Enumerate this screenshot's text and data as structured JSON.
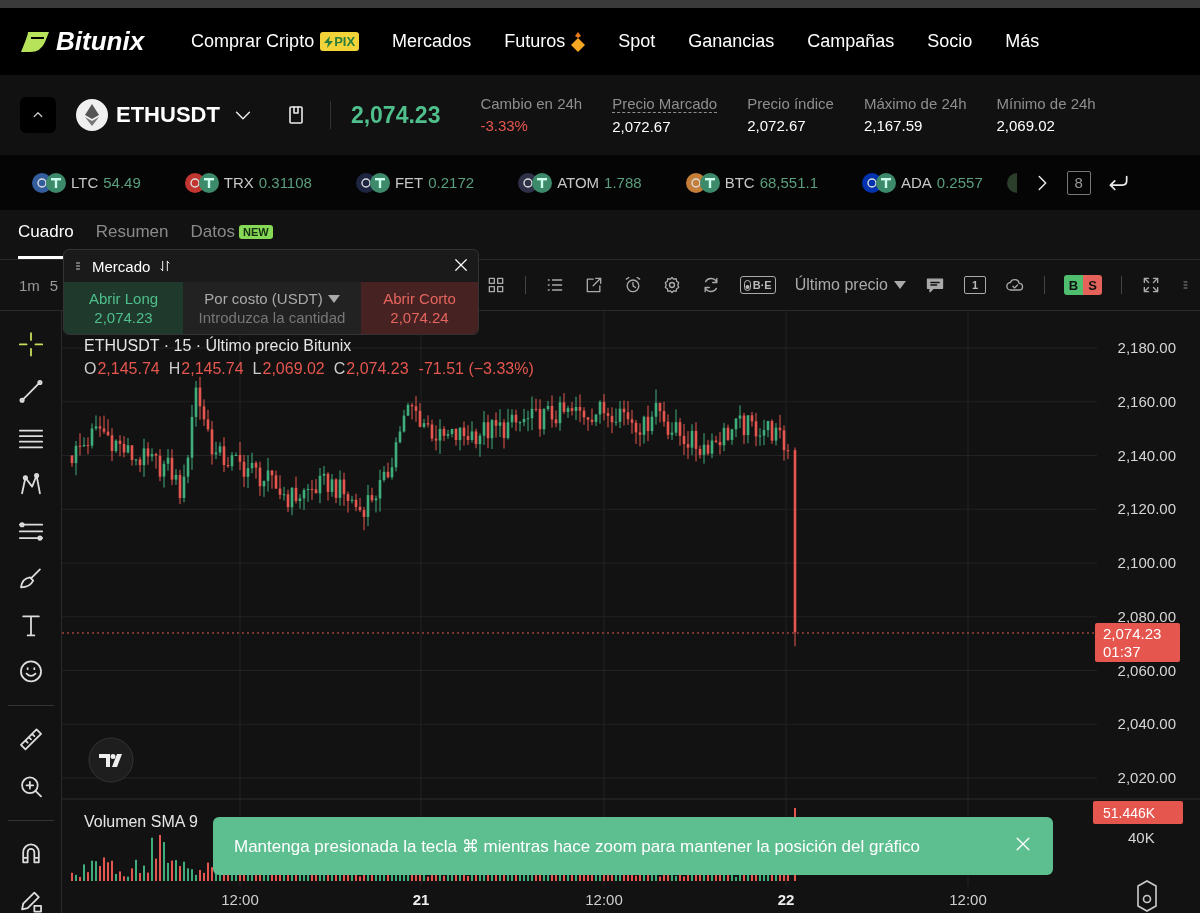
{
  "nav": {
    "brand": "Bitunix",
    "items": [
      {
        "label": "Comprar Cripto",
        "kind": "badge",
        "badge": "PIX"
      },
      {
        "label": "Mercados",
        "kind": "plain"
      },
      {
        "label": "Futuros",
        "kind": "icon"
      },
      {
        "label": "Spot",
        "kind": "plain"
      },
      {
        "label": "Ganancias",
        "kind": "plain"
      },
      {
        "label": "Campañas",
        "kind": "plain"
      },
      {
        "label": "Socio",
        "kind": "plain"
      },
      {
        "label": "Más",
        "kind": "plain"
      }
    ]
  },
  "pair": {
    "symbol": "ETHUSDT",
    "price": "2,074.23"
  },
  "stats": [
    {
      "label": "Cambio en 24h",
      "value": "-3.33%",
      "color": "#e5564f",
      "underlined": false
    },
    {
      "label": "Precio Marcado",
      "value": "2,072.67",
      "color": "#ffffff",
      "underlined": true
    },
    {
      "label": "Precio índice",
      "value": "2,072.67",
      "color": "#ffffff",
      "underlined": false
    },
    {
      "label": "Máximo de 24h",
      "value": "2,167.59",
      "color": "#ffffff",
      "underlined": false
    },
    {
      "label": "Mínimo de 24h",
      "value": "2,069.02",
      "color": "#ffffff",
      "underlined": false
    }
  ],
  "ticker": [
    {
      "symbol": "LTC",
      "price": "54.49",
      "color": "#345d9d"
    },
    {
      "symbol": "TRX",
      "price": "0.31108",
      "color": "#c23631"
    },
    {
      "symbol": "FET",
      "price": "0.2172",
      "color": "#1d2540"
    },
    {
      "symbol": "ATOM",
      "price": "1.788",
      "color": "#2e3148"
    },
    {
      "symbol": "BTC",
      "price": "68,551.1",
      "color": "#c57d3a"
    },
    {
      "symbol": "ADA",
      "price": "0.2557",
      "color": "#0033ad"
    }
  ],
  "ticker_counter": "8",
  "tabs": [
    {
      "label": "Cuadro",
      "selected": true
    },
    {
      "label": "Resumen",
      "selected": false
    },
    {
      "label": "Datos",
      "selected": false,
      "badge": "NEW"
    }
  ],
  "toolbar": {
    "intervals": [
      "1m",
      "5"
    ],
    "ob_badge": "B·E",
    "price_source": "Último precio",
    "counter": "1",
    "buy_label": "B",
    "sell_label": "S"
  },
  "order_panel": {
    "title": "Mercado",
    "long": {
      "label": "Abrir Long",
      "price": "2,074.23"
    },
    "amount": {
      "mode": "Por costo (USDT)",
      "placeholder": "Introduzca la cantidad"
    },
    "short": {
      "label": "Abrir Corto",
      "price": "2,074.24"
    }
  },
  "legend": {
    "title": "ETHUSDT · 15 · Último precio Bitunix",
    "ohlc": [
      {
        "label": "O",
        "value": "2,145.74"
      },
      {
        "label": "H",
        "value": "2,145.74"
      },
      {
        "label": "L",
        "value": "2,069.02"
      },
      {
        "label": "C",
        "value": "2,074.23"
      }
    ],
    "change": "-71.51 (−3.33%)"
  },
  "price_axis": [
    "2,180.00",
    "2,160.00",
    "2,140.00",
    "2,120.00",
    "2,100.00",
    "2,080.00",
    "2,060.00",
    "2,040.00",
    "2,020.00"
  ],
  "last_price": {
    "price": "2,074.23",
    "countdown": "01:37"
  },
  "volume": {
    "title": "Volumen SMA 9",
    "last": "51.446K",
    "axis": "40K"
  },
  "time_axis": [
    {
      "label": "12:00",
      "kind": "time"
    },
    {
      "label": "21",
      "kind": "day"
    },
    {
      "label": "12:00",
      "kind": "time"
    },
    {
      "label": "22",
      "kind": "day"
    },
    {
      "label": "12:00",
      "kind": "time"
    }
  ],
  "toast": {
    "message": "Mantenga presionada la tecla ⌘ mientras hace zoom para mantener la posición del gráfico"
  }
}
